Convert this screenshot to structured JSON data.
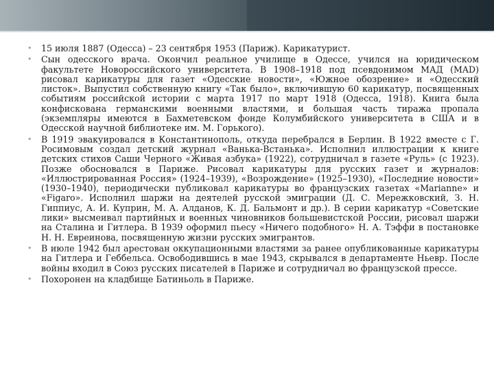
{
  "colors": {
    "header_dark": "#2b3a44",
    "header_light": "#a8b3b8",
    "bullet": "#8fa2ad",
    "text": "#1a1a1a"
  },
  "bullet_glyph": "•",
  "items": [
    {
      "text": "15 июля 1887 (Одесса) – 23 сентября 1953 (Париж). Карикатурист."
    },
    {
      "text": "Сын одесского врача. Окончил реальное училище в Одессе, учился на юридическом факультете Новороссийского университета. В 1908–1918 под псевдонимом МАД (MAD) рисовал карикатуры для газет «Одесские новости», «Южное обозрение» и «Одесский листок». Выпустил собственную книгу «Так было», включившую 60 карикатур, посвященных событиям российской истории с марта 1917 по март 1918 (Одесса, 1918). Книга была конфискована германскими военными властями, и большая часть тиража пропала (экземпляры имеются в Бахметевском фонде Колумбийского университета в США и в Одесской научной библиотеке им. М. Горького)."
    },
    {
      "text": "В 1919 эвакуировался в Константинополь, откуда перебрался в Берлин. В 1922 вместе с Г. Росимовым создал детский журнал «Ванька-Встанька». Исполнил иллюстрации к книге детских стихов Саши Черного «Живая азбука» (1922), сотрудничал в газете «Руль» (с 1923). Позже обосновался в Париже. Рисовал карикатуры для русских газет и журналов: «Иллюстрированная Россия» (1924–1939), «Возрождение» (1925–1930), «Последние новости» (1930–1940), периодически публиковал карикатуры во французских газетах «Marianne» и «Figaro». Исполнил шаржи на деятелей русской эмиграции (Д. С. Мережковский, З. Н. Гиппиус, А. И. Куприн, М. А. Алданов, К. Д. Бальмонт и др.). В серии карикатур «Советские лики» высмеивал партийных и военных чиновников большевистской России, рисовал шаржи на Сталина и Гитлера. В 1939 оформил пьесу «Ничего подобного» Н. А. Тэффи в постановке Н. Н. Евреинова, посвященную жизни русских эмигрантов."
    },
    {
      "text": "В июле 1942 был арестован оккупационными властями за ранее опубликованные карикатуры на Гитлера и Геббельса. Освободившись в мае 1943, скрывался в департаменте Ньевр. После войны входил в Союз русских писателей в Париже и сотрудничал во французской прессе."
    },
    {
      "text": "Похоронен на кладбище Батиньоль в Париже."
    }
  ]
}
